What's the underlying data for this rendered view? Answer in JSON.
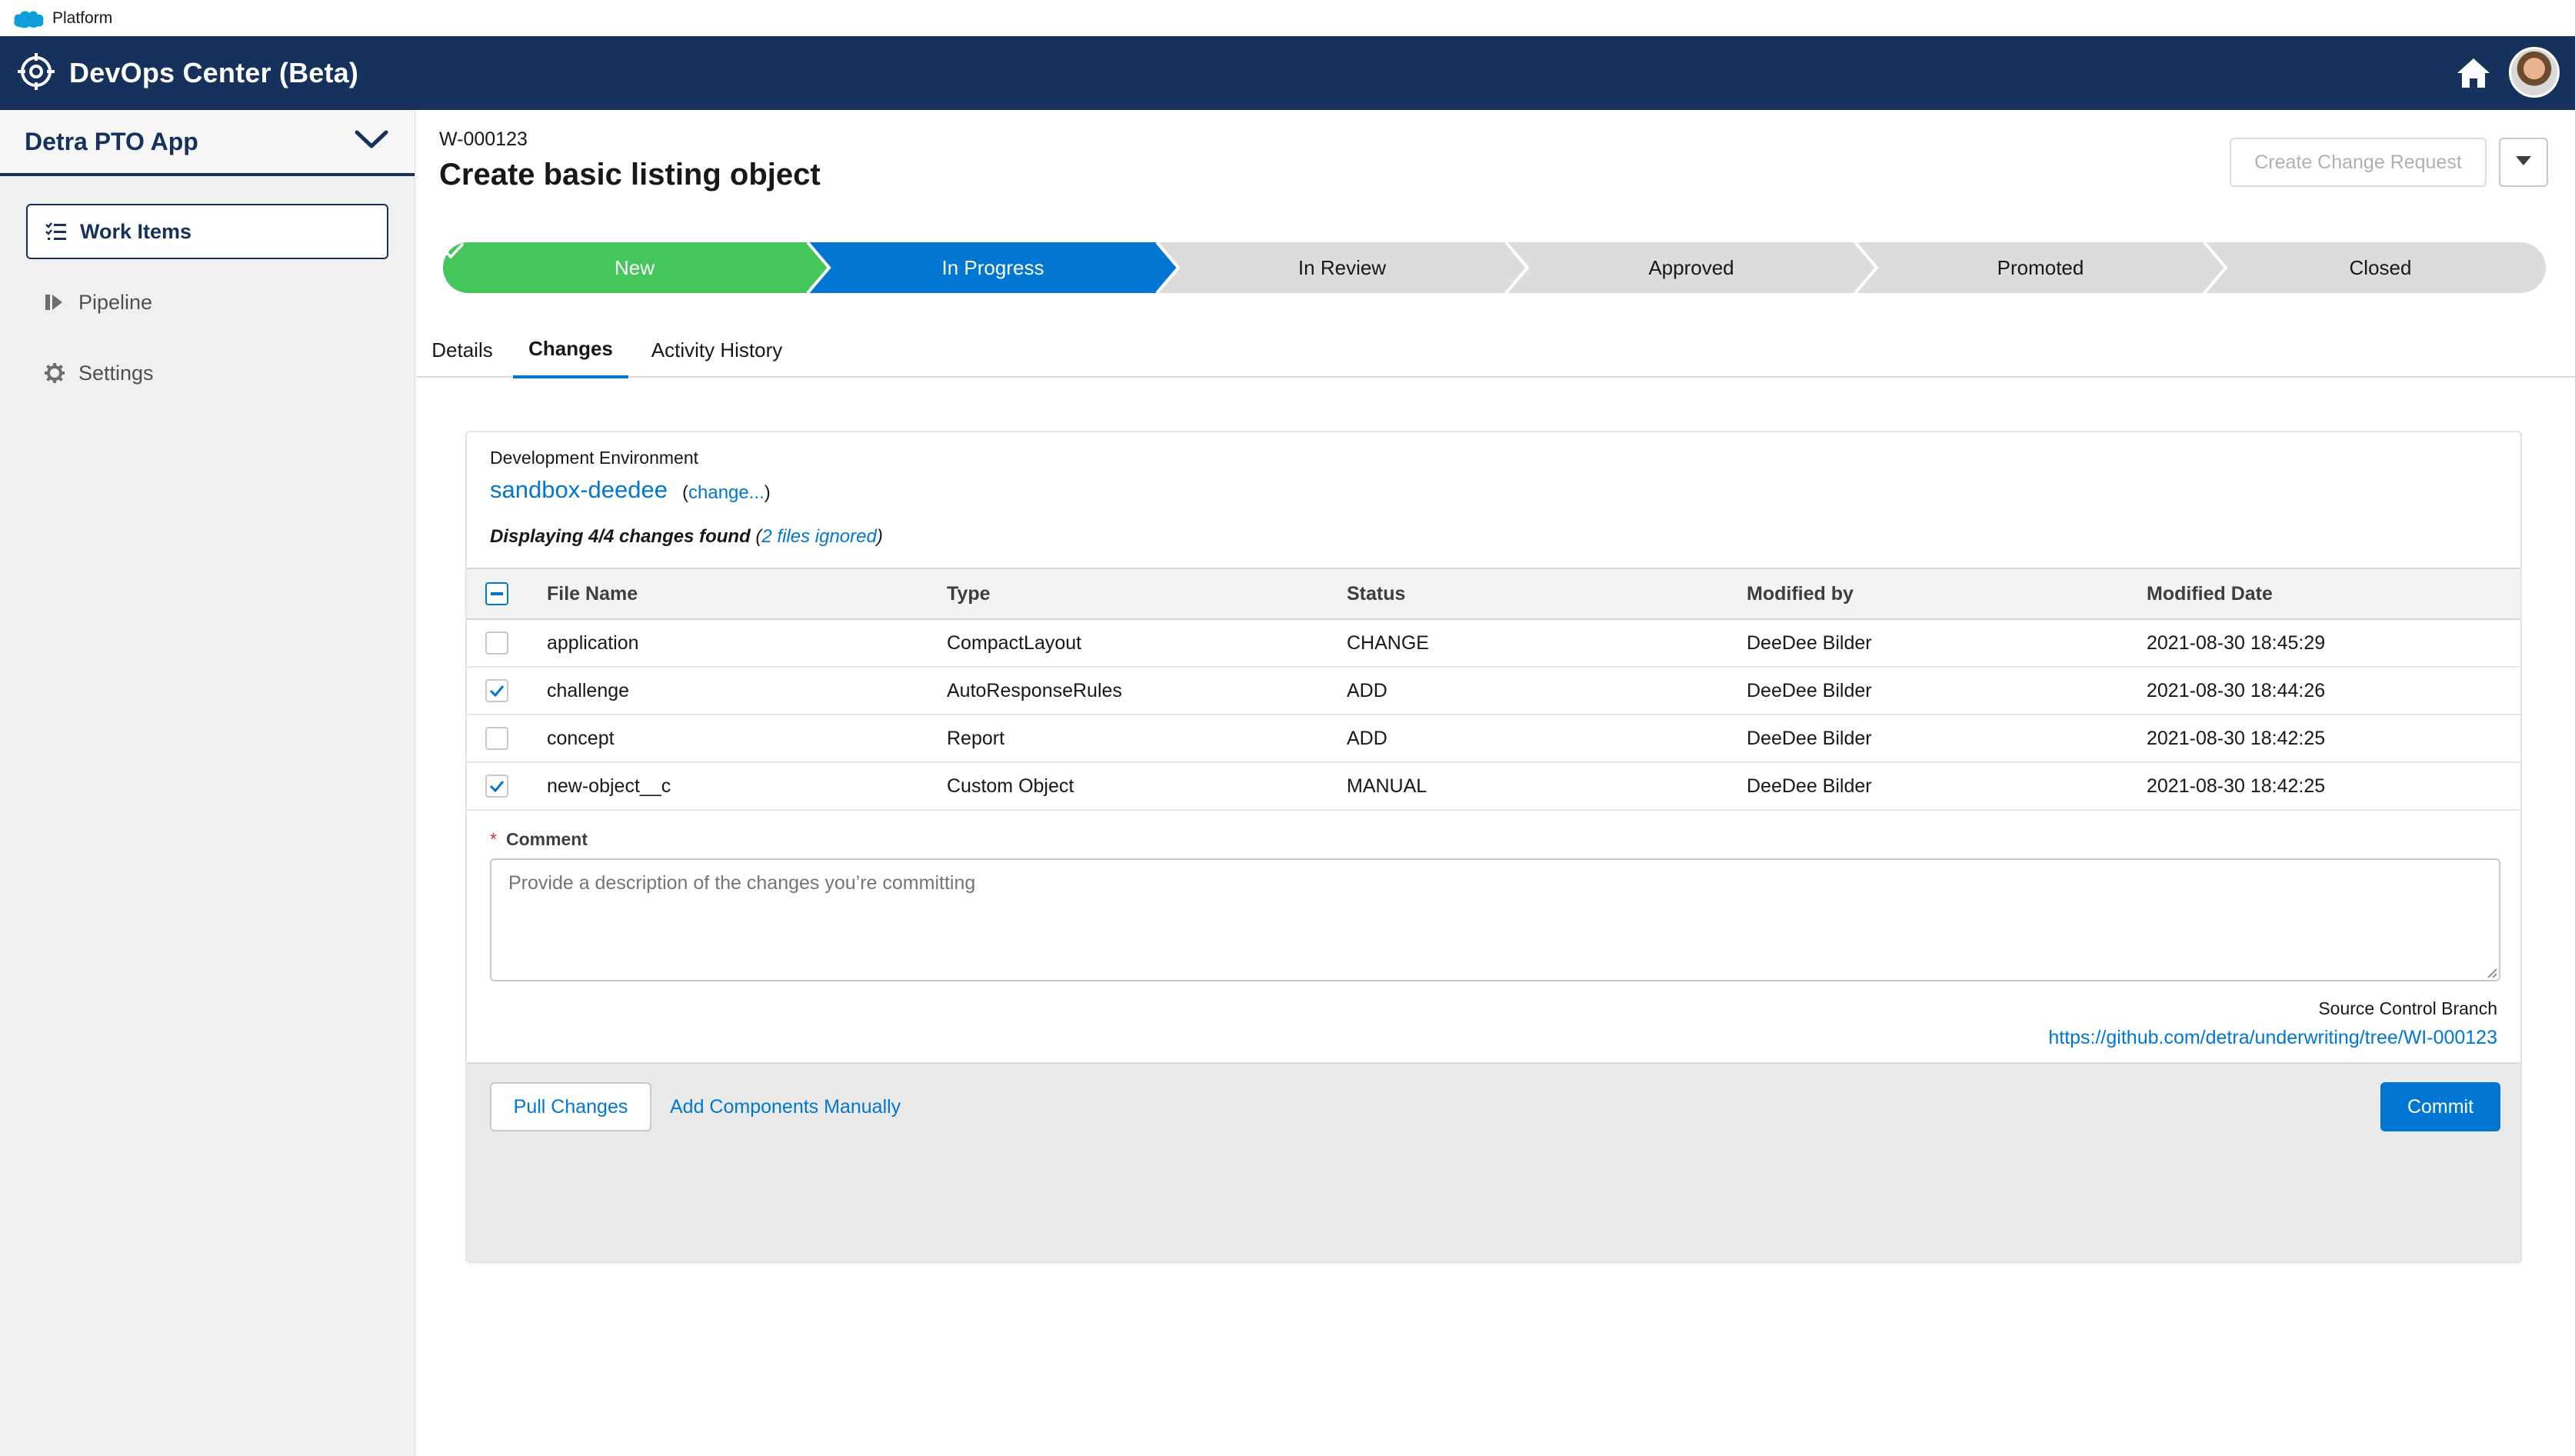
{
  "topbar": {
    "label": "Platform",
    "logo_icon": "salesforce-cloud-icon"
  },
  "header": {
    "title": "DevOps Center (Beta)",
    "logo_icon": "devops-target-icon",
    "home_icon": "home-icon"
  },
  "sidebar": {
    "app_name": "Detra PTO App",
    "items": [
      {
        "label": "Work Items",
        "icon": "list-icon",
        "active": true
      },
      {
        "label": "Pipeline",
        "icon": "pipeline-icon",
        "active": false
      },
      {
        "label": "Settings",
        "icon": "gear-icon",
        "active": false
      }
    ]
  },
  "work_item": {
    "id": "W-000123",
    "title": "Create basic listing object",
    "create_change_request": "Create Change Request"
  },
  "stages": [
    {
      "label": "New",
      "state": "complete"
    },
    {
      "label": "In Progress",
      "state": "current"
    },
    {
      "label": "In Review",
      "state": "incomplete"
    },
    {
      "label": "Approved",
      "state": "incomplete"
    },
    {
      "label": "Promoted",
      "state": "incomplete"
    },
    {
      "label": "Closed",
      "state": "incomplete"
    }
  ],
  "colors": {
    "complete": "#45c65a",
    "current": "#0176d3",
    "incomplete": "#dcdcdc",
    "header": "#16325c"
  },
  "tabs": [
    {
      "label": "Details",
      "active": false
    },
    {
      "label": "Changes",
      "active": true
    },
    {
      "label": "Activity History",
      "active": false
    }
  ],
  "changes": {
    "env_label": "Development Environment",
    "env_name": "sandbox-deedee",
    "env_change_link": "change...",
    "displaying_prefix": "Displaying 4/4 changes found",
    "files_ignored": "2 files ignored",
    "columns": [
      "File Name",
      "Type",
      "Status",
      "Modified by",
      "Modified Date"
    ],
    "rows": [
      {
        "checked": false,
        "file": "application",
        "type": "CompactLayout",
        "status": "CHANGE",
        "modified_by": "DeeDee Bilder",
        "date": "2021-08-30 18:45:29"
      },
      {
        "checked": true,
        "file": "challenge",
        "type": "AutoResponseRules",
        "status": "ADD",
        "modified_by": "DeeDee Bilder",
        "date": "2021-08-30 18:44:26"
      },
      {
        "checked": false,
        "file": "concept",
        "type": "Report",
        "status": "ADD",
        "modified_by": "DeeDee Bilder",
        "date": "2021-08-30 18:42:25"
      },
      {
        "checked": true,
        "file": "new-object__c",
        "type": "Custom Object",
        "status": "MANUAL",
        "modified_by": "DeeDee Bilder",
        "date": "2021-08-30 18:42:25"
      }
    ],
    "comment_label": "Comment",
    "comment_required_mark": "*",
    "comment_placeholder": "Provide a description of the changes you’re committing",
    "source_branch_label": "Source Control Branch",
    "source_branch_url": "https://github.com/detra/underwriting/tree/WI-000123",
    "pull_button": "Pull Changes",
    "add_components_link": "Add Components Manually",
    "commit_button": "Commit"
  }
}
